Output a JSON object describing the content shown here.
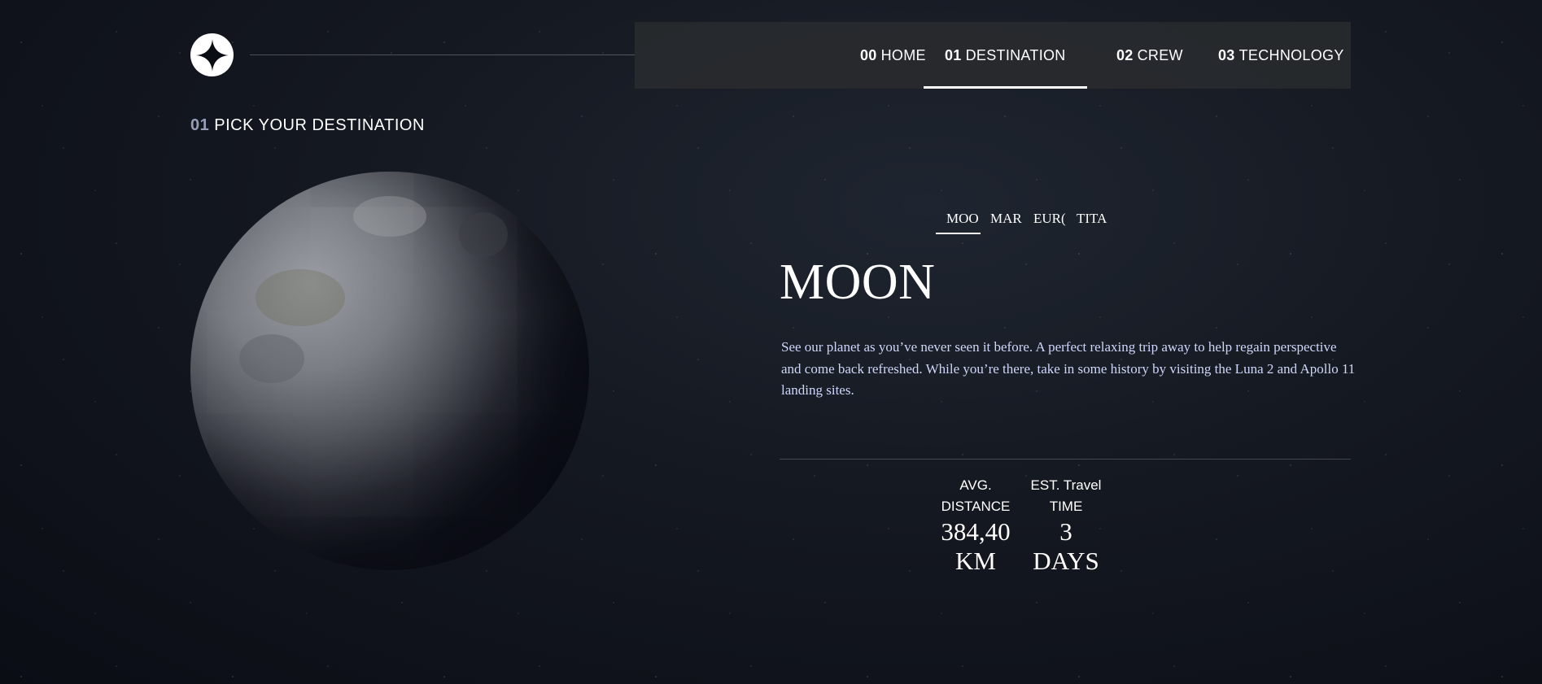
{
  "header": {
    "logo_icon": "star-logo-icon",
    "nav": [
      {
        "number": "00",
        "label": "HOME",
        "active": false
      },
      {
        "number": "01",
        "label": "DESTINATION",
        "active": true
      },
      {
        "number": "02",
        "label": "CREW",
        "active": false
      },
      {
        "number": "03",
        "label": "TECHNOLOGY",
        "active": false
      }
    ]
  },
  "page": {
    "subtitle_number": "01",
    "subtitle_text": "PICK YOUR DESTINATION"
  },
  "destination": {
    "tabs": [
      "MOO",
      "MAR",
      "EUR(",
      "TITA"
    ],
    "active_tab": "MOON",
    "name": "MOON",
    "description": "See our planet as you’ve never seen it before. A perfect relaxing trip away to help regain perspective and come back refreshed. While you’re there, take in some history by visiting the Luna 2 and Apollo 11 landing sites.",
    "stats": {
      "distance_label_line1": "AVG.",
      "distance_label_line2": "DISTANCE",
      "distance_value_line1": "384,40",
      "distance_value_line2": "KM",
      "travel_label_line1": "EST. Travel",
      "travel_label_line2": "TIME",
      "travel_value_line1": "3",
      "travel_value_line2": "DAYS"
    }
  },
  "colors": {
    "background": "#0b0d15",
    "accent_text": "#d0d6f9",
    "nav_background": "#28292e"
  }
}
